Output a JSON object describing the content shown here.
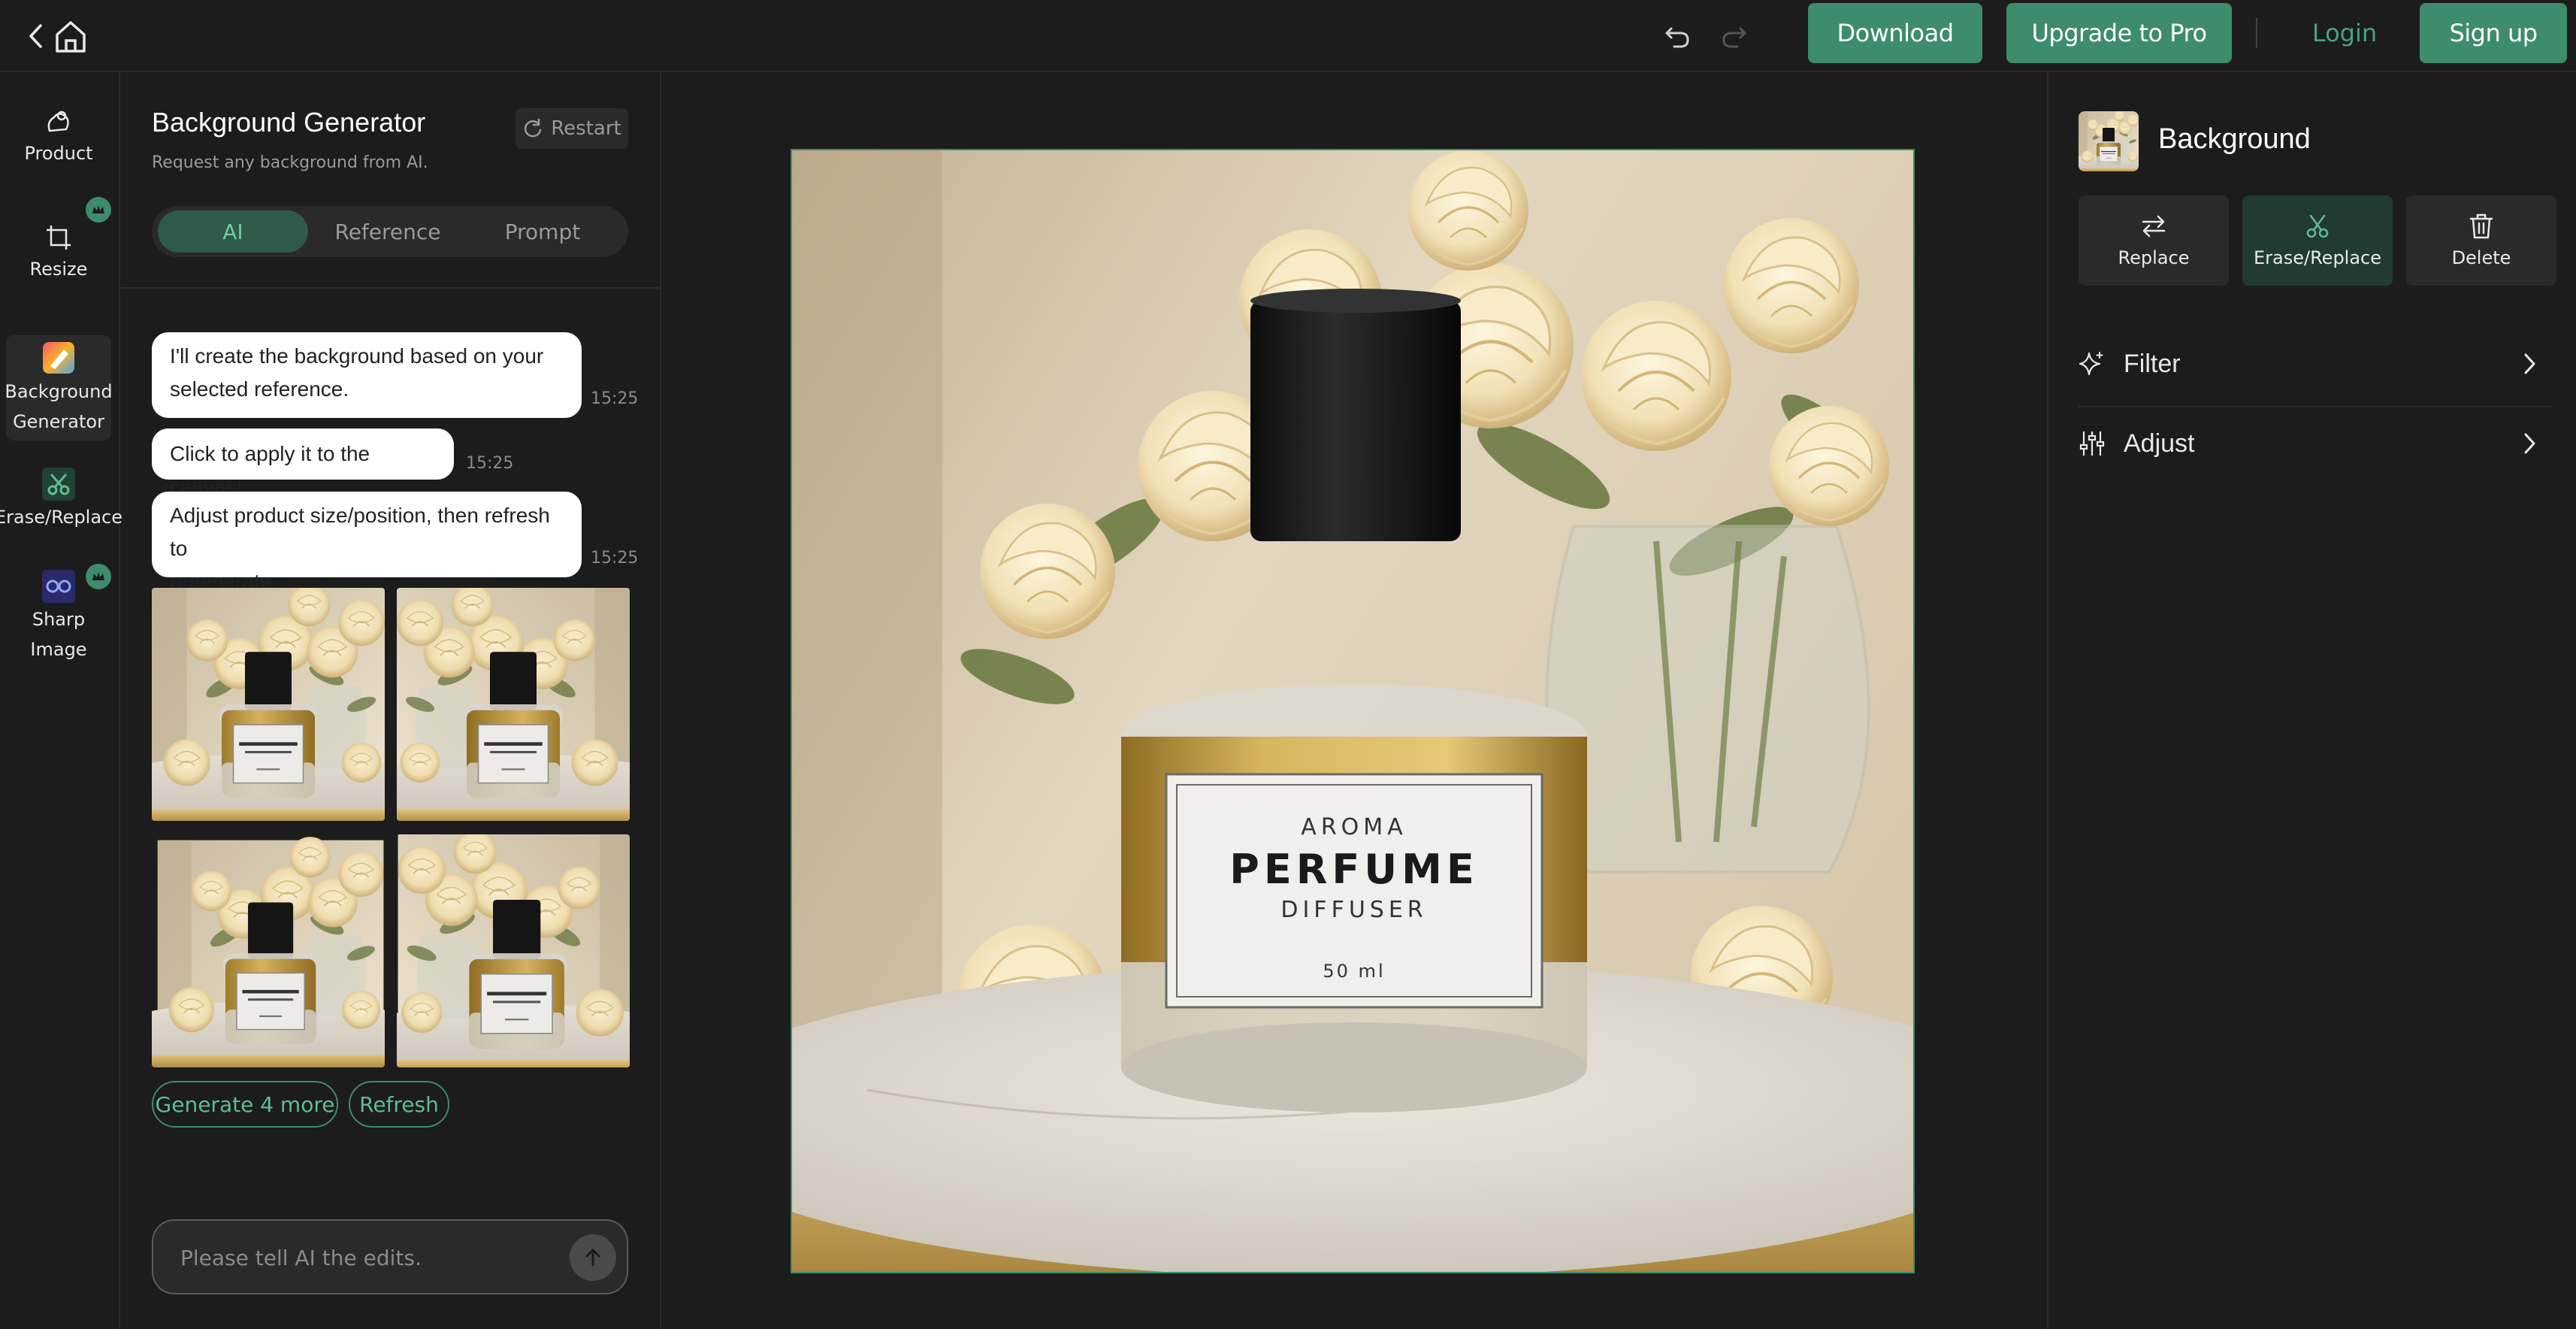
{
  "topbar": {
    "back_icon": "chevron-left-icon",
    "home_icon": "home-icon",
    "undo_icon": "undo-icon",
    "redo_icon": "redo-icon",
    "download_label": "Download",
    "upgrade_label": "Upgrade to Pro",
    "login_label": "Login",
    "signup_label": "Sign up"
  },
  "rail": {
    "items": [
      {
        "label": "Product",
        "icon": "product-icon"
      },
      {
        "label": "Resize",
        "icon": "crop-icon",
        "badge": true
      },
      {
        "label_line1": "Background",
        "label_line2": "Generator",
        "icon": "background-generator-icon",
        "active": true
      },
      {
        "label": "Erase/Replace",
        "icon": "scissors-icon"
      },
      {
        "label_line1": "Sharp",
        "label_line2": "Image",
        "icon": "sharpen-icon",
        "badge": true
      }
    ]
  },
  "panel": {
    "title": "Background Generator",
    "subtitle": "Request any background from AI.",
    "restart_label": "Restart",
    "tabs": [
      {
        "label": "AI",
        "active": true
      },
      {
        "label": "Reference",
        "active": false
      },
      {
        "label": "Prompt",
        "active": false
      }
    ],
    "messages": [
      {
        "line1": "I'll create the background based on your",
        "line2": "selected reference.",
        "time": "15:25"
      },
      {
        "line1": "Click to apply it to the canvas!",
        "time": "15:25"
      },
      {
        "line1": "Adjust product size/position, then refresh to",
        "line2": "regenerate.",
        "time": "15:25"
      }
    ],
    "generate_more_label": "Generate 4 more",
    "refresh_label": "Refresh",
    "input_placeholder": "Please tell AI the edits."
  },
  "canvas": {
    "label_brand": "AROMA",
    "label_name": "PERFUME",
    "label_type": "DIFFUSER",
    "label_volume": "50 ml"
  },
  "right_panel": {
    "layer_name": "Background",
    "actions": [
      {
        "label": "Replace",
        "icon": "replace-icon"
      },
      {
        "label": "Erase/Replace",
        "icon": "scissors-icon",
        "active": true
      },
      {
        "label": "Delete",
        "icon": "trash-icon"
      }
    ],
    "rows": [
      {
        "label": "Filter",
        "icon": "sparkle-icon"
      },
      {
        "label": "Adjust",
        "icon": "sliders-icon"
      }
    ]
  },
  "colors": {
    "accent": "#3d8c6b",
    "accent_text": "#5ebd92",
    "background": "#1c1c1c",
    "surface": "#2a2a2a"
  }
}
